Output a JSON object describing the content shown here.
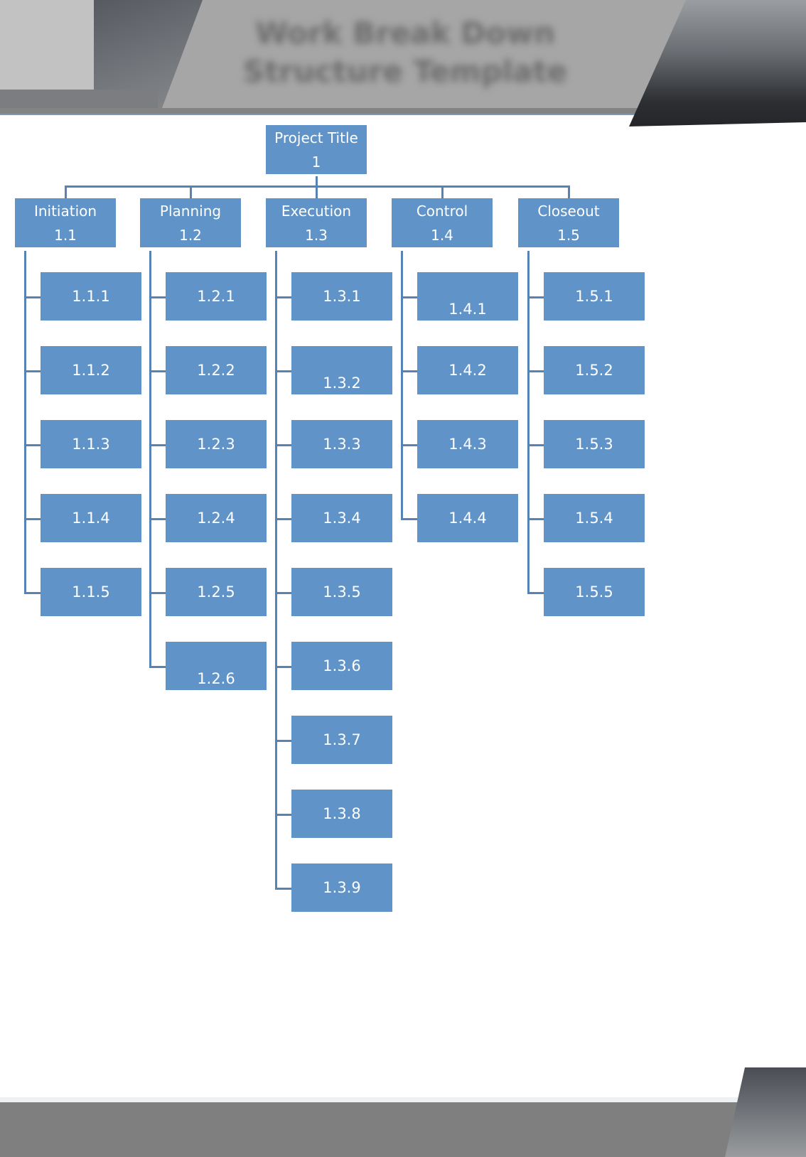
{
  "header": {
    "title": "Work Break Down Structure Template"
  },
  "colors": {
    "box_fill": "#6094c8",
    "connector": "#5683b6",
    "box_text": "#ffffff",
    "header_gray": "#a6a6a6",
    "footer_gray": "#7f7f7f"
  },
  "wbs": {
    "root": {
      "label": "Project Title",
      "code": "1"
    },
    "phases": [
      {
        "label": "Initiation",
        "code": "1.1",
        "children": [
          "1.1.1",
          "1.1.2",
          "1.1.3",
          "1.1.4",
          "1.1.5"
        ]
      },
      {
        "label": "Planning",
        "code": "1.2",
        "children": [
          "1.2.1",
          "1.2.2",
          "1.2.3",
          "1.2.4",
          "1.2.5",
          "1.2.6"
        ]
      },
      {
        "label": "Execution",
        "code": "1.3",
        "children": [
          "1.3.1",
          "1.3.2",
          "1.3.3",
          "1.3.4",
          "1.3.5",
          "1.3.6",
          "1.3.7",
          "1.3.8",
          "1.3.9"
        ]
      },
      {
        "label": "Control",
        "code": "1.4",
        "children": [
          "1.4.1",
          "1.4.2",
          "1.4.3",
          "1.4.4"
        ]
      },
      {
        "label": "Closeout",
        "code": "1.5",
        "children": [
          "1.5.1",
          "1.5.2",
          "1.5.3",
          "1.5.4",
          "1.5.5"
        ]
      }
    ]
  }
}
